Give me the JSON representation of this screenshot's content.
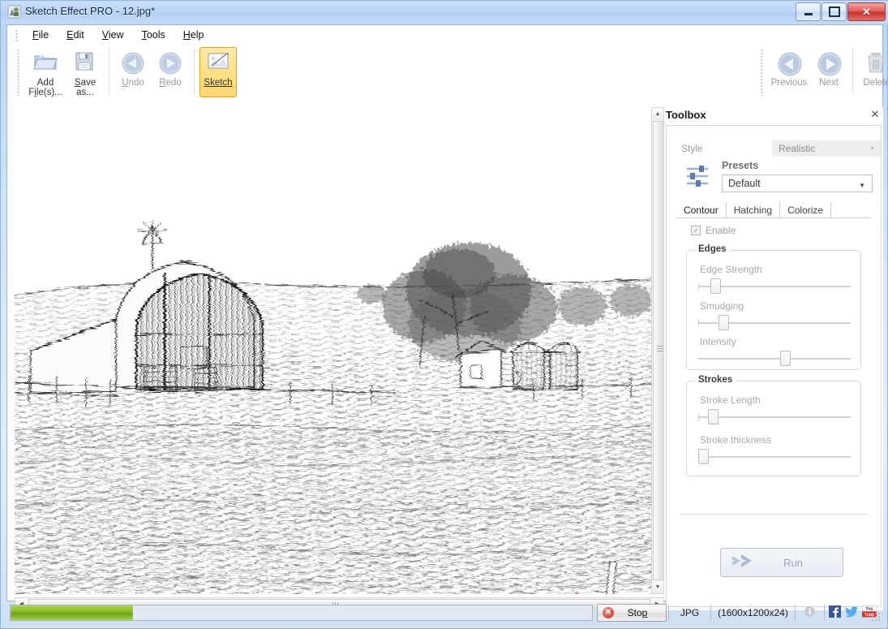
{
  "window": {
    "title": "Sketch Effect PRO - 12.jpg*",
    "icon": "app-icon",
    "controls": {
      "minimize": "minimize",
      "restore": "restore",
      "close": "close"
    }
  },
  "menu": {
    "items": [
      {
        "label": "File",
        "accel": "F"
      },
      {
        "label": "Edit",
        "accel": "E"
      },
      {
        "label": "View",
        "accel": "V"
      },
      {
        "label": "Tools",
        "accel": "T"
      },
      {
        "label": "Help",
        "accel": "H"
      }
    ]
  },
  "toolbar": {
    "left_buttons": [
      {
        "name": "add-files",
        "line1": "Add",
        "line2": "File(s)...",
        "icon": "folder-icon",
        "state": "enabled"
      },
      {
        "name": "save-as",
        "line1": "Save",
        "line2": "as...",
        "icon": "floppy-disk-icon",
        "state": "enabled"
      }
    ],
    "history_buttons": [
      {
        "name": "undo",
        "label": "Undo",
        "icon": "undo-arrow-icon",
        "state": "disabled"
      },
      {
        "name": "redo",
        "label": "Redo",
        "icon": "redo-arrow-icon",
        "state": "disabled"
      }
    ],
    "sketch_button": {
      "name": "sketch",
      "label": "Sketch",
      "icon": "sketch-picture-icon",
      "state": "active"
    },
    "right_buttons": [
      {
        "name": "previous",
        "label": "Previous",
        "icon": "left-circle-arrow-icon",
        "state": "disabled"
      },
      {
        "name": "next",
        "label": "Next",
        "icon": "right-circle-arrow-icon",
        "state": "disabled"
      }
    ],
    "delete_button": {
      "name": "delete",
      "label": "Delete",
      "icon": "trash-icon",
      "state": "disabled"
    },
    "expander_icon": "chevron-down-icon"
  },
  "image_view": {
    "alt": "pencil-sketch of a barn, silos, trees and a field",
    "vertical_scrollbar": {
      "up_icon": "caret-up-icon",
      "down_icon": "caret-down-icon",
      "grip": "scroll-grip"
    },
    "horizontal_scrollbar": {
      "left_icon": "caret-left-icon",
      "right_icon": "caret-right-icon",
      "grip": "scroll-grip"
    }
  },
  "toolbox": {
    "title": "Toolbox",
    "close_icon": "close-icon",
    "style": {
      "label": "Style",
      "value": "Realistic",
      "arrow_icon": "chevron-down-icon"
    },
    "presets": {
      "icon": "sliders-icon",
      "label": "Presets",
      "value": "Default",
      "arrow_icon": "chevron-down-icon"
    },
    "tabs": [
      {
        "label": "Contour",
        "active": true
      },
      {
        "label": "Hatching",
        "active": false
      },
      {
        "label": "Colorize",
        "active": false
      }
    ],
    "enable": {
      "label": "Enable",
      "checked": true,
      "check_icon": "check-icon"
    },
    "groups": [
      {
        "title": "Edges",
        "sliders": [
          {
            "label": "Edge Strength",
            "percent": 11
          },
          {
            "label": "Smudging",
            "percent": 16
          },
          {
            "label": "Intensity",
            "percent": 55
          }
        ]
      },
      {
        "title": "Strokes",
        "sliders": [
          {
            "label": "Stroke Length",
            "percent": 9
          },
          {
            "label": "Stroke thickness",
            "percent": 1
          }
        ]
      }
    ],
    "run_button": {
      "label": "Run",
      "icon": "double-arrow-icon",
      "state": "disabled"
    }
  },
  "statusbar": {
    "progress_percent": 21,
    "stop_button": {
      "label": "Stop",
      "accel": "p",
      "icon": "stop-circle-icon"
    },
    "format": "JPG",
    "dimensions": "(1600x1200x24)",
    "info_icon": "info-icon",
    "social": [
      {
        "name": "facebook-icon",
        "label": "f"
      },
      {
        "name": "twitter-icon",
        "label": "t"
      },
      {
        "name": "youtube-icon",
        "label": "You Tube"
      }
    ],
    "resize_grip": "resize-grip-icon"
  },
  "colors": {
    "accent_active": "#ffdf85",
    "progress_green": "#8ec425",
    "close_red": "#c8332f",
    "facebook_blue": "#3b5998",
    "twitter_blue": "#55acee",
    "youtube_red": "#e52d27"
  }
}
